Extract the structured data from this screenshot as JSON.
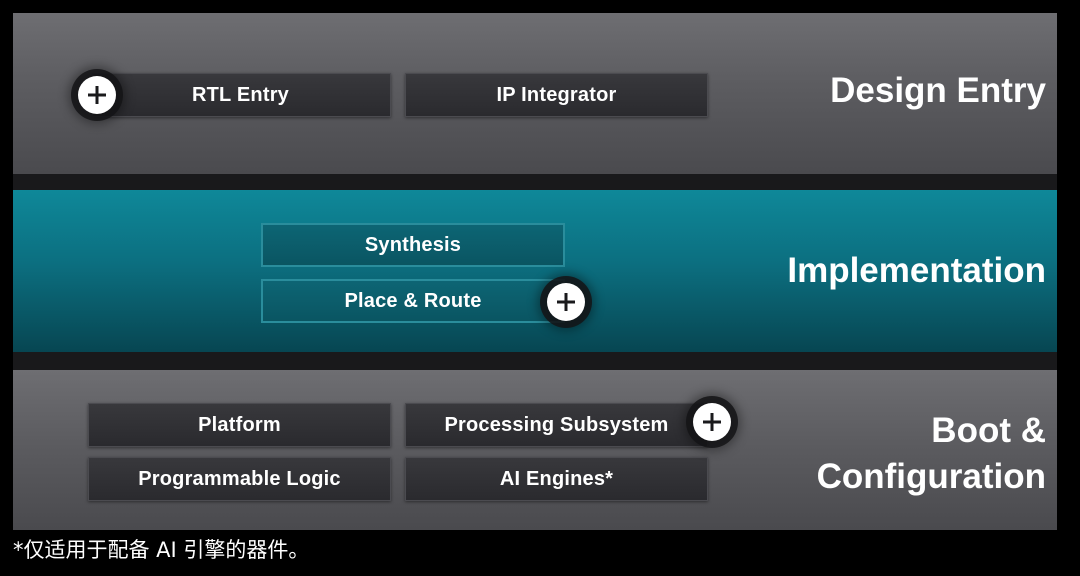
{
  "design_entry": {
    "title": "Design Entry",
    "boxes": [
      "RTL Entry",
      "IP Integrator"
    ]
  },
  "implementation": {
    "title": "Implementation",
    "boxes": [
      "Synthesis",
      "Place & Route"
    ]
  },
  "boot_configuration": {
    "title_line1": "Boot &",
    "title_line2": "Configuration",
    "boxes": [
      "Platform",
      "Processing Subsystem",
      "Programmable Logic",
      "AI Engines*"
    ]
  },
  "footnote": "*仅适用于配备 AI 引擎的器件。",
  "icons": {
    "expand": "plus-icon"
  },
  "colors": {
    "gray_band": "#5c5c60",
    "teal_band": "#0c6f80",
    "box_dark": "#2f2f33",
    "text": "#ffffff"
  }
}
